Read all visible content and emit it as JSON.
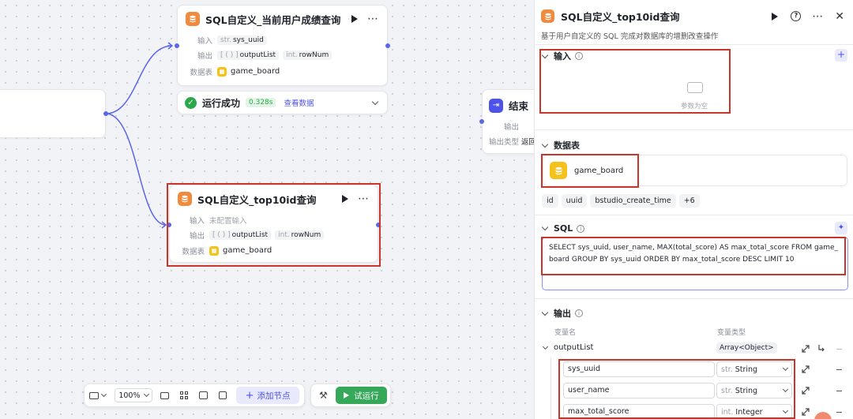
{
  "canvas": {
    "node1": {
      "title": "SQL自定义_当前用户成绩查询",
      "input_label": "输入",
      "input_type": "str.",
      "input_value": "sys_uuid",
      "output_label": "输出",
      "out1_type": "[ ( ) ]",
      "out1_value": "outputList",
      "out2_type": "int.",
      "out2_value": "rowNum",
      "table_label": "数据表",
      "table_value": "game_board"
    },
    "run_status": {
      "text": "运行成功",
      "time": "0.328s",
      "link": "查看数据"
    },
    "node2": {
      "title": "SQL自定义_top10id查询",
      "input_label": "输入",
      "input_value": "未配置输入",
      "output_label": "输出",
      "out1_type": "[ ( ) ]",
      "out1_value": "outputList",
      "out2_type": "int.",
      "out2_value": "rowNum",
      "table_label": "数据表",
      "table_value": "game_board"
    },
    "end_node": {
      "title": "结束",
      "output_label": "输出",
      "output_type_label": "输出类型",
      "output_type_value": "返回"
    },
    "toolbar": {
      "zoom": "100%",
      "add_node": "添加节点",
      "test_run": "试运行"
    }
  },
  "panel": {
    "title": "SQL自定义_top10id查询",
    "description": "基于用户自定义的 SQL 完成对数据库的增删改查操作",
    "input_section": {
      "title": "输入",
      "empty_text": "参数为空"
    },
    "table_section": {
      "title": "数据表",
      "table_name": "game_board",
      "fields": [
        "id",
        "uuid",
        "bstudio_create_time",
        "+6"
      ]
    },
    "sql_section": {
      "title": "SQL",
      "query": "SELECT sys_uuid, user_name, MAX(total_score) AS max_total_score FROM game_board GROUP BY sys_uuid ORDER BY max_total_score DESC LIMIT 10"
    },
    "output_section": {
      "title": "输出",
      "col_name": "变量名",
      "col_type": "变量类型",
      "root_name": "outputList",
      "root_type": "Array<Object>",
      "rows": [
        {
          "name": "sys_uuid",
          "type_prefix": "str.",
          "type": "String"
        },
        {
          "name": "user_name",
          "type_prefix": "str.",
          "type": "String"
        },
        {
          "name": "max_total_score",
          "type_prefix": "int.",
          "type": "Integer"
        }
      ]
    }
  },
  "colors": {
    "accent": "#4d53e8",
    "node_icon": "#f08a3c",
    "table_icon": "#f5c21b",
    "success": "#2ba84a",
    "run_button": "#35a85a",
    "annotation_red": "#c8352b"
  }
}
